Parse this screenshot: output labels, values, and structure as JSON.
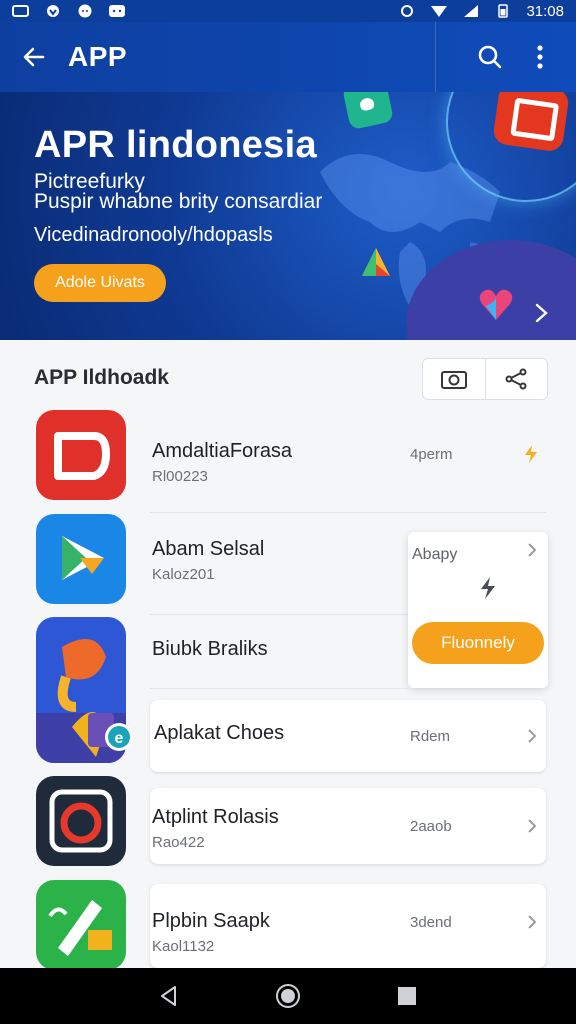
{
  "status_bar": {
    "time": "31:08"
  },
  "app_bar": {
    "title": "APP"
  },
  "hero": {
    "title": "APR lindonesia",
    "subtitle_line1": "Pictreefurky",
    "subtitle_line2": "Puspir whabne brity consardiar",
    "tagline": "Vicedinadronooly/hdopasls",
    "cta_label": "Adole Uivats"
  },
  "section": {
    "title": "APP Ildhoadk"
  },
  "apps": [
    {
      "name": "AmdaltiaForasa",
      "sub": "Rl00223",
      "meta": "4perm"
    },
    {
      "name": "Abam Selsal",
      "sub": "Kaloz201",
      "meta": ""
    },
    {
      "name": "Biubk Braliks",
      "sub": "",
      "meta": ""
    },
    {
      "name": "Aplakat Choes",
      "sub": "",
      "meta": "Rdem"
    },
    {
      "name": "Atplint Rolasis",
      "sub": "Rao422",
      "meta": "2aaob"
    },
    {
      "name": "Plpbin Saapk",
      "sub": "Kaol1132",
      "meta": "3dend"
    }
  ],
  "popup": {
    "label": "Abapy",
    "button_label": "Fluonnely"
  },
  "colors": {
    "primary": "#0d3f9f",
    "accent": "#f5a11c",
    "background": "#f5f6f8"
  },
  "icons": [
    "arrow-left-icon",
    "search-icon",
    "more-vertical-icon",
    "camera-icon",
    "share-icon",
    "chevron-right-icon",
    "bolt-icon",
    "back-triangle-icon",
    "home-circle-icon",
    "recents-square-icon"
  ]
}
